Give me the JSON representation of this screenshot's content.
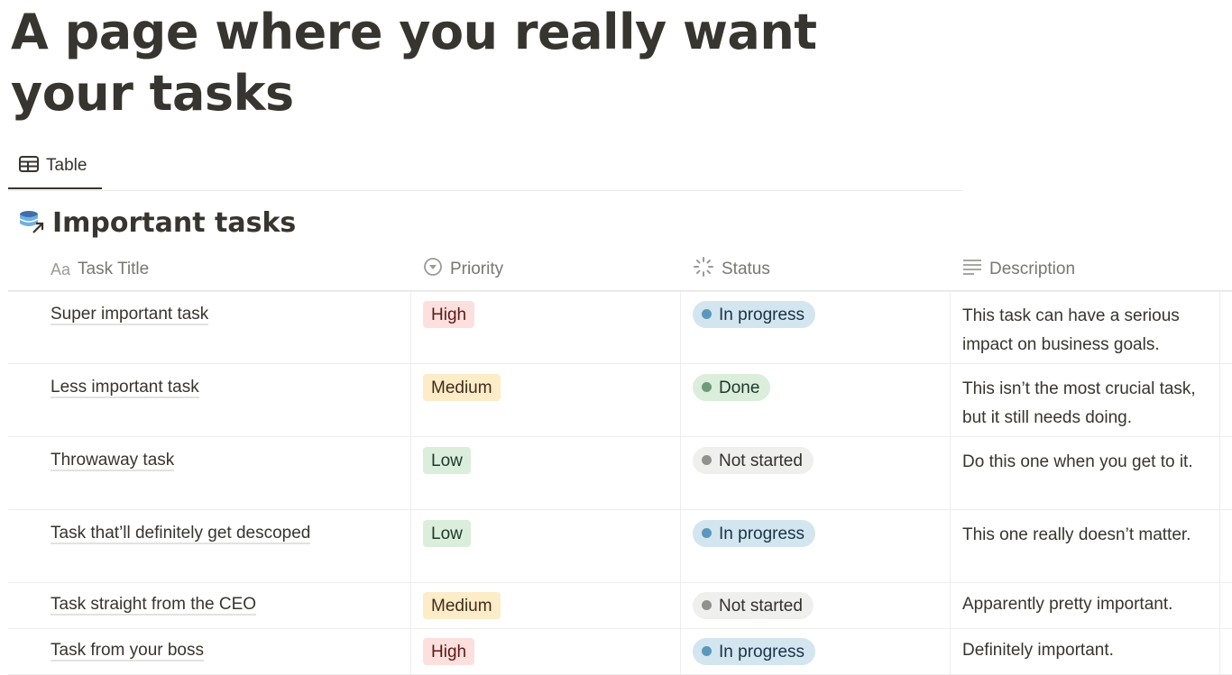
{
  "page": {
    "title": "A page where you really want your tasks"
  },
  "view_tabs": [
    {
      "label": "Table",
      "icon": "table-icon",
      "active": true
    }
  ],
  "database": {
    "title": "Important tasks",
    "icon": "linked-database-icon"
  },
  "columns": [
    {
      "label": "Task Title",
      "icon": "text-aa-icon"
    },
    {
      "label": "Priority",
      "icon": "select-icon"
    },
    {
      "label": "Status",
      "icon": "status-spinner-icon"
    },
    {
      "label": "Description",
      "icon": "text-lines-icon"
    }
  ],
  "priority_styles": {
    "High": {
      "bg": "#fde0dd",
      "fg": "#5d1715"
    },
    "Medium": {
      "bg": "#fcecc8",
      "fg": "#402c1b"
    },
    "Low": {
      "bg": "#dbeddb",
      "fg": "#1c3829"
    }
  },
  "status_styles": {
    "In progress": {
      "bg": "#d3e5ef",
      "fg": "#183347",
      "dot": "#5b97bd"
    },
    "Done": {
      "bg": "#dbeddb",
      "fg": "#1c3829",
      "dot": "#6c9b7d"
    },
    "Not started": {
      "bg": "#efefed",
      "fg": "#32302c",
      "dot": "#91918e"
    }
  },
  "rows": [
    {
      "title": "Super important task",
      "priority": "High",
      "status": "In progress",
      "description": "This task can have a serious impact on business goals."
    },
    {
      "title": "Less important task",
      "priority": "Medium",
      "status": "Done",
      "description": "This isn’t the most crucial task, but it still needs doing."
    },
    {
      "title": "Throwaway task",
      "priority": "Low",
      "status": "Not started",
      "description": "Do this one when you get to it."
    },
    {
      "title": "Task that’ll definitely get descoped",
      "priority": "Low",
      "status": "In progress",
      "description": "This one really doesn’t matter."
    },
    {
      "title": "Task straight from the CEO",
      "priority": "Medium",
      "status": "Not started",
      "description": "Apparently pretty important."
    },
    {
      "title": "Task from your boss",
      "priority": "High",
      "status": "In progress",
      "description": "Definitely important."
    }
  ]
}
